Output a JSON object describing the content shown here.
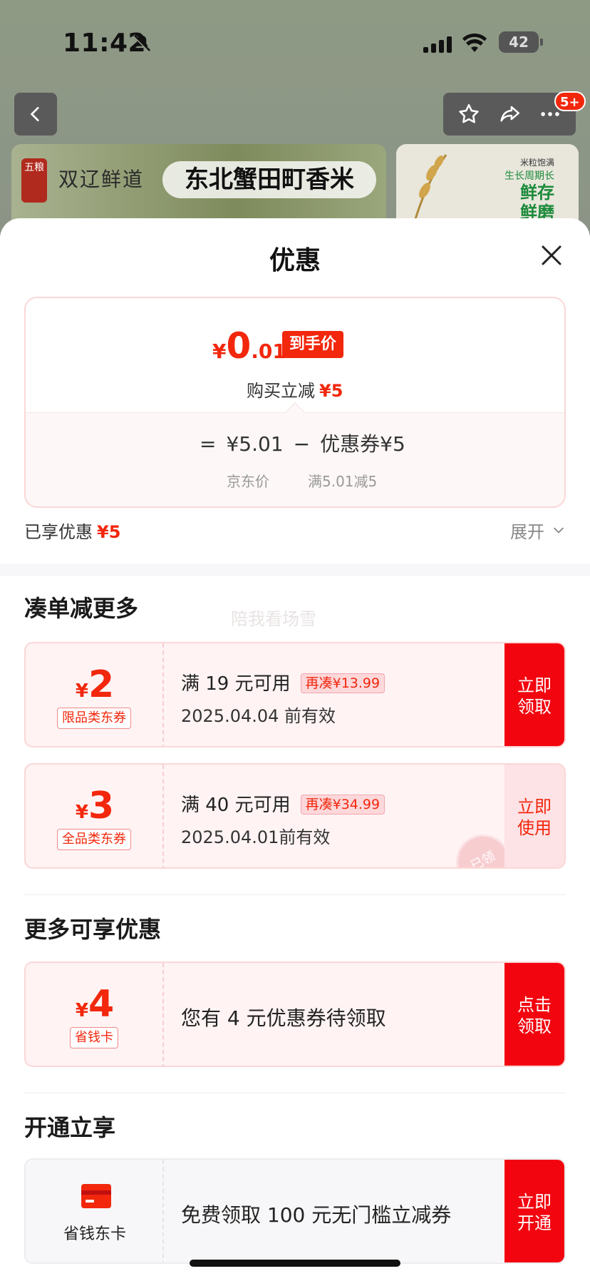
{
  "status_bar": {
    "time": "11:42",
    "battery": "42"
  },
  "product_header": {
    "badge": "5+",
    "brand_seal": "五粮",
    "brand_name": "双辽鲜道",
    "product_title": "东北蟹田町香米",
    "side_banner": {
      "line1": "米粒饱满",
      "line2": "生长周期长",
      "line3": "鲜存",
      "line4": "鲜磨"
    }
  },
  "sheet": {
    "title": "优惠",
    "price": {
      "yen": "¥",
      "integer": "0",
      "decimal": ".01",
      "tag": "到手价",
      "instant_label": "购买立减",
      "instant_value": "¥5",
      "formula": {
        "eq": "=",
        "jd_price": "¥5.01",
        "minus": "−",
        "coupon_label": "优惠券",
        "coupon_value": "¥5"
      },
      "jd_price_label": "京东价",
      "coupon_rule": "满5.01减5"
    },
    "enjoyed_label": "已享优惠",
    "enjoyed_value": "¥5",
    "expand_label": "展开",
    "section_more": "凑单减更多",
    "watermark": "陪我看场雪",
    "coupons": [
      {
        "yen": "¥",
        "amount": "2",
        "type": "限品类东券",
        "condition": "满 19 元可用",
        "need": "再凑¥13.99",
        "date": "2025.04.04 前有效",
        "button": "立即\n领取"
      },
      {
        "yen": "¥",
        "amount": "3",
        "type": "全品类东券",
        "condition": "满 40 元可用",
        "need": "再凑¥34.99",
        "date": "2025.04.01前有效",
        "button": "立即\n使用",
        "stamp": "已领"
      }
    ],
    "section_extra": "更多可享优惠",
    "saver_card": {
      "yen": "¥",
      "amount": "4",
      "type": "省钱卡",
      "text": "您有 4 元优惠券待领取",
      "button": "点击\n领取"
    },
    "section_open": "开通立享",
    "open_card": {
      "name": "省钱东卡",
      "text": "免费领取 100 元无门槛立减券",
      "button": "立即\n开通"
    }
  },
  "colors": {
    "accent": "#f2270c",
    "coupon_bg": "#fff3f4"
  }
}
